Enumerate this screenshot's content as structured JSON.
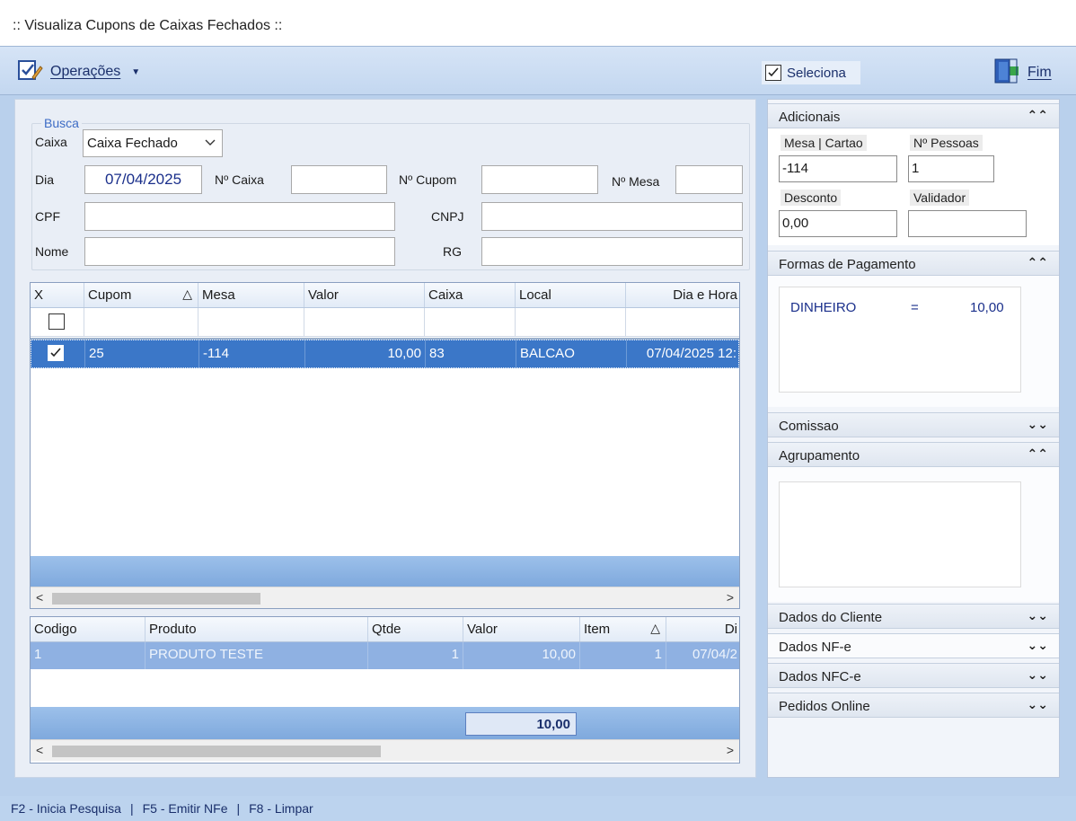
{
  "window": {
    "title": ":: Visualiza Cupons de Caixas Fechados ::"
  },
  "toolbar": {
    "operations_label": "Operações",
    "select_label": "Seleciona",
    "select_checked": true,
    "exit_label": "Fim"
  },
  "search": {
    "legend": "Busca",
    "caixa_label": "Caixa",
    "caixa_value": "Caixa Fechado",
    "dia_label": "Dia",
    "dia_value": "07/04/2025",
    "ncaixa_label": "Nº Caixa",
    "ncaixa_value": "",
    "ncupom_label": "Nº Cupom",
    "ncupom_value": "",
    "nmesa_label": "Nº Mesa",
    "nmesa_value": "",
    "cpf_label": "CPF",
    "cpf_value": "",
    "cnpj_label": "CNPJ",
    "cnpj_value": "",
    "nome_label": "Nome",
    "nome_value": "",
    "rg_label": "RG",
    "rg_value": ""
  },
  "coupons_grid": {
    "columns": [
      "X",
      "Cupom",
      "Mesa",
      "Valor",
      "Caixa",
      "Local",
      "Dia e Hora"
    ],
    "sort_indicator": "△",
    "rows": [
      {
        "checked": true,
        "cupom": "25",
        "mesa": "-114",
        "valor": "10,00",
        "caixa": "83",
        "local": "BALCAO",
        "dia_hora": "07/04/2025 12:"
      }
    ]
  },
  "items_grid": {
    "columns": [
      "Codigo",
      "Produto",
      "Qtde",
      "Valor",
      "Item",
      "Di"
    ],
    "sort_indicator": "△",
    "rows": [
      {
        "codigo": "1",
        "produto": "PRODUTO TESTE",
        "qtde": "1",
        "valor": "10,00",
        "item": "1",
        "dia": "07/04/2"
      }
    ],
    "total": "10,00"
  },
  "right_panel": {
    "adicionais": {
      "title": "Adicionais",
      "mesa_cartao_label": "Mesa | Cartao",
      "mesa_cartao_value": "-114",
      "pessoas_label": "Nº Pessoas",
      "pessoas_value": "1",
      "desconto_label": "Desconto",
      "desconto_value": "0,00",
      "validador_label": "Validador",
      "validador_value": ""
    },
    "pagamento": {
      "title": "Formas de Pagamento",
      "method": "DINHEIRO",
      "equals": "=",
      "amount": "10,00"
    },
    "comissao_title": "Comissao",
    "agrupamento_title": "Agrupamento",
    "dados_cliente_title": "Dados do Cliente",
    "dados_nfe_title": "Dados NF-e",
    "dados_nfce_title": "Dados NFC-e",
    "pedidos_online_title": "Pedidos Online"
  },
  "statusbar": {
    "items": [
      "F2 - Inicia Pesquisa",
      "F5 - Emitir NFe",
      "F8 - Limpar"
    ],
    "separator": "|"
  },
  "colors": {
    "selection": "#3b77c8",
    "panel_bg": "#b9d0ec",
    "link_text": "#1a2f6b"
  }
}
